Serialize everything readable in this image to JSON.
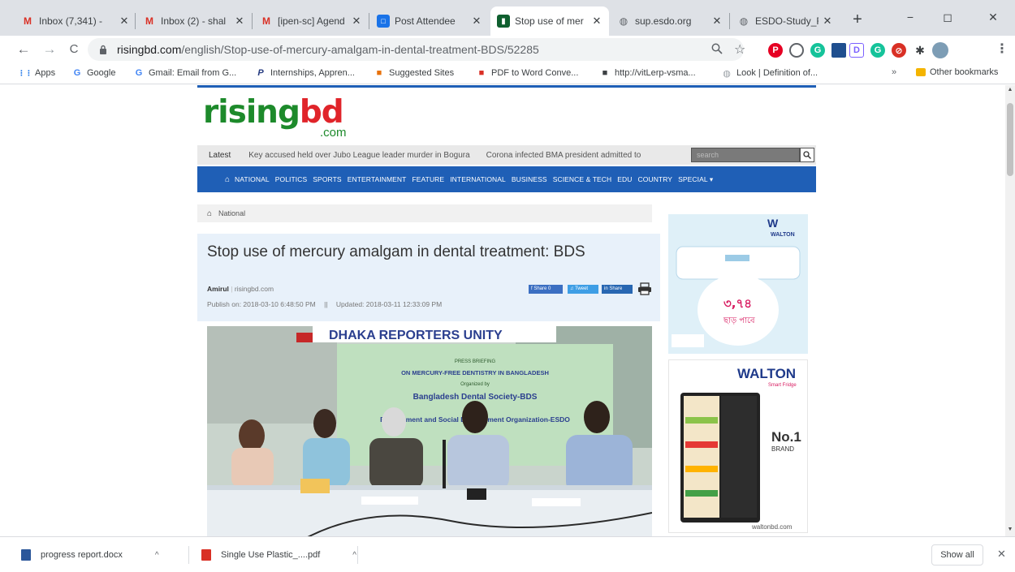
{
  "tabs": [
    {
      "title": "Inbox (7,341) - ",
      "favicon": "M",
      "favicon_color": "#d93025",
      "active": false
    },
    {
      "title": "Inbox (2) - shal",
      "favicon": "M",
      "favicon_color": "#d93025",
      "active": false
    },
    {
      "title": "[ipen-sc] Agend",
      "favicon": "M",
      "favicon_color": "#d93025",
      "active": false
    },
    {
      "title": "Post Attendee",
      "favicon": "□",
      "favicon_color": "#1a73e8",
      "active": false
    },
    {
      "title": "Stop use of mer",
      "favicon": "▮",
      "favicon_color": "#0f5f2f",
      "active": true
    },
    {
      "title": "sup.esdo.org",
      "favicon": "◍",
      "favicon_color": "#5f6368",
      "active": false
    },
    {
      "title": "ESDO-Study_Re",
      "favicon": "◍",
      "favicon_color": "#5f6368",
      "active": false
    }
  ],
  "window": {
    "minimize": "−",
    "restore": "◻",
    "close": "✕",
    "new_tab": "+"
  },
  "toolbar": {
    "back": "←",
    "forward": "→",
    "reload": "C",
    "url_host": "risingbd.com",
    "url_path": "/english/Stop-use-of-mercury-amalgam-in-dental-treatment-BDS/52285"
  },
  "bookmarks": [
    {
      "label": "Apps",
      "icon": "⋮⋮",
      "icon_color": "#1a73e8"
    },
    {
      "label": "Google",
      "icon": "G",
      "icon_color": "#4285f4"
    },
    {
      "label": "Gmail: Email from G...",
      "icon": "G",
      "icon_color": "#4285f4"
    },
    {
      "label": "Internships, Appren...",
      "icon": "P",
      "icon_color": "#253b80"
    },
    {
      "label": "Suggested Sites",
      "icon": "■",
      "icon_color": "#e8710a"
    },
    {
      "label": "PDF to Word Conve...",
      "icon": "■",
      "icon_color": "#d93025"
    },
    {
      "label": "http://vitLerp-vsma...",
      "icon": "■",
      "icon_color": "#3c4043"
    },
    {
      "label": "Look | Definition of...",
      "icon": "◍",
      "icon_color": "#9aa0a6"
    }
  ],
  "bookmarks_more": "»",
  "other_bookmarks": "Other bookmarks",
  "site": {
    "logo_rising": "rising",
    "logo_bd": "bd",
    "logo_com": ".com",
    "latest_label": "Latest",
    "tickers": [
      "Key accused held over Jubo League leader murder in Bogura",
      "Corona infected BMA president admitted to"
    ],
    "search_placeholder": "search",
    "nav_items": [
      "NATIONAL",
      "POLITICS",
      "SPORTS",
      "ENTERTAINMENT",
      "FEATURE",
      "INTERNATIONAL",
      "BUSINESS",
      "SCIENCE & TECH",
      "EDU",
      "COUNTRY",
      "SPECIAL ▾"
    ],
    "breadcrumb": "National"
  },
  "article": {
    "headline": "Stop use of mercury amalgam in dental treatment: BDS",
    "author": "Amirul",
    "source": "risingbd.com",
    "published": "Publish on: 2018-03-10 6:48:50 PM",
    "separator": "||",
    "updated": "Updated: 2018-03-11 12:33:09 PM",
    "share_facebook": "Share 0",
    "share_twitter": "Tweet",
    "share_linkedin": "Share",
    "photo_banner": "DHAKA REPORTERS UNITY",
    "photo_lines": [
      "PRESS BRIEFING",
      "ON MERCURY-FREE DENTISTRY IN BANGLADESH",
      "Organized by",
      "Bangladesh Dental Society-BDS",
      "and",
      "Environment and Social Development Organization-ESDO"
    ]
  },
  "ads": {
    "ad1_brand": "WALTON",
    "ad1_price": "৩,৭৪",
    "ad1_bn": "ছাড় পাবে",
    "ad2_brand": "WALTON",
    "ad2_tagline": "Smart Fridge",
    "ad2_no": "No.1",
    "ad2_brand_label": "BRAND",
    "ad2_url": "waltonbd.com"
  },
  "downloads": [
    {
      "name": "progress report.docx",
      "icon_color": "#2b579a"
    },
    {
      "name": "Single Use Plastic_....pdf",
      "icon_color": "#d93025"
    }
  ],
  "show_all": "Show all",
  "shelf_close": "✕"
}
